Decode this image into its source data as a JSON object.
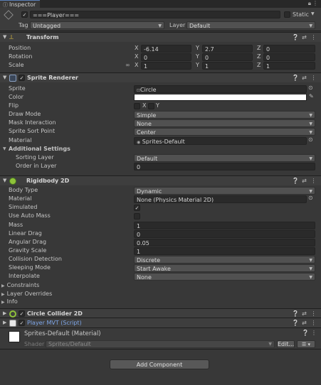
{
  "tab": {
    "title": "Inspector"
  },
  "gameobject": {
    "name": "===Player===",
    "static_label": "Static",
    "tag_label": "Tag",
    "tag_value": "Untagged",
    "layer_label": "Layer",
    "layer_value": "Default"
  },
  "transform": {
    "title": "Transform",
    "position_label": "Position",
    "rotation_label": "Rotation",
    "scale_label": "Scale",
    "x": "X",
    "y": "Y",
    "z": "Z",
    "position": [
      "-6.14",
      "2.7",
      "0"
    ],
    "rotation": [
      "0",
      "0",
      "0"
    ],
    "scale": [
      "1",
      "1",
      "1"
    ]
  },
  "sprite_renderer": {
    "title": "Sprite Renderer",
    "sprite_label": "Sprite",
    "sprite_value": "Circle",
    "color_label": "Color",
    "flip_label": "Flip",
    "flip_x": "X",
    "flip_y": "Y",
    "draw_mode_label": "Draw Mode",
    "draw_mode_value": "Simple",
    "mask_label": "Mask Interaction",
    "mask_value": "None",
    "sort_point_label": "Sprite Sort Point",
    "sort_point_value": "Center",
    "material_label": "Material",
    "material_value": "Sprites-Default",
    "additional_label": "Additional Settings",
    "sorting_layer_label": "Sorting Layer",
    "sorting_layer_value": "Default",
    "order_label": "Order in Layer",
    "order_value": "0"
  },
  "rigidbody": {
    "title": "Rigidbody 2D",
    "body_type_label": "Body Type",
    "body_type_value": "Dynamic",
    "material_label": "Material",
    "material_value": "None (Physics Material 2D)",
    "simulated_label": "Simulated",
    "auto_mass_label": "Use Auto Mass",
    "mass_label": "Mass",
    "mass_value": "1",
    "linear_drag_label": "Linear Drag",
    "linear_drag_value": "0",
    "angular_drag_label": "Angular Drag",
    "angular_drag_value": "0.05",
    "gravity_label": "Gravity Scale",
    "gravity_value": "1",
    "collision_label": "Collision Detection",
    "collision_value": "Discrete",
    "sleeping_label": "Sleeping Mode",
    "sleeping_value": "Start Awake",
    "interpolate_label": "Interpolate",
    "interpolate_value": "None",
    "constraints_label": "Constraints",
    "layer_overrides_label": "Layer Overrides",
    "info_label": "Info"
  },
  "circle_collider": {
    "title": "Circle Collider 2D"
  },
  "script": {
    "title": "Player MVT (Script)"
  },
  "material_preview": {
    "title": "Sprites-Default (Material)",
    "shader_label": "Shader",
    "shader_value": "Sprites/Default",
    "edit_label": "Edit..."
  },
  "add_component": {
    "label": "Add Component"
  },
  "colors": {
    "panel": "#383838",
    "script_blue": "#7ea6e8",
    "field": "#2a2a2a",
    "dropdown": "#515151"
  }
}
